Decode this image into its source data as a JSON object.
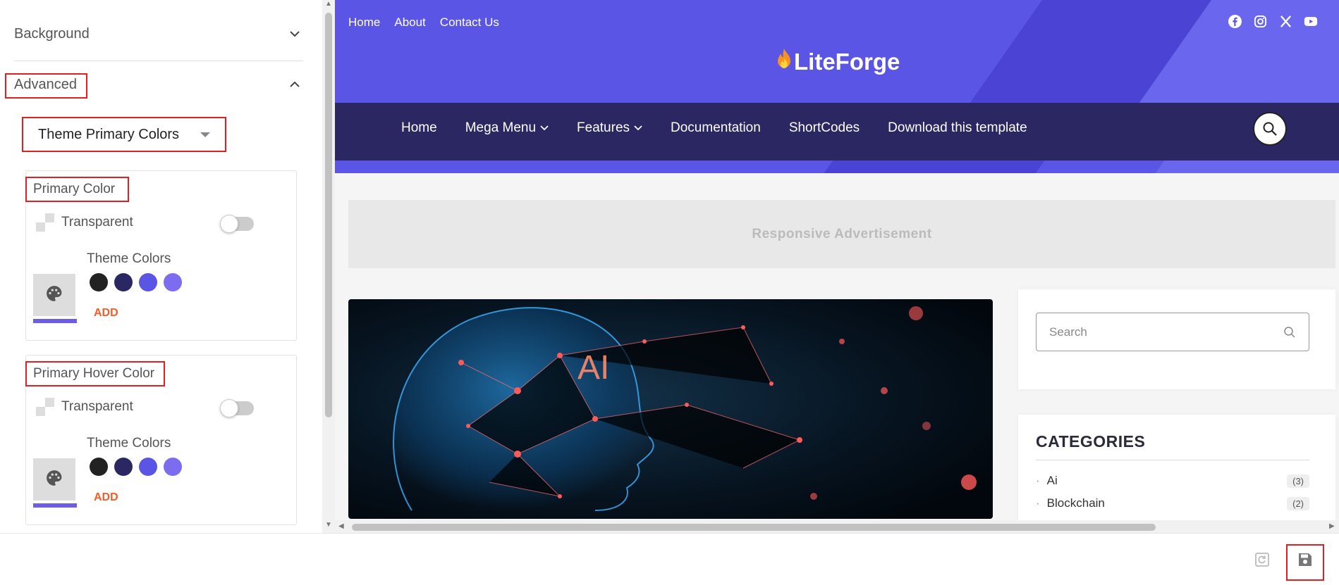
{
  "panel": {
    "background_label": "Background",
    "advanced_label": "Advanced",
    "select_value": "Theme Primary Colors",
    "cards": [
      {
        "title": "Primary Color",
        "transparent_label": "Transparent",
        "theme_colors_label": "Theme Colors",
        "add_label": "ADD",
        "transparent_on": false
      },
      {
        "title": "Primary Hover Color",
        "transparent_label": "Transparent",
        "theme_colors_label": "Theme Colors",
        "add_label": "ADD",
        "transparent_on": false
      }
    ],
    "theme_colors": [
      "#222222",
      "#2a2762",
      "#5b55e6",
      "#7b6cf0"
    ],
    "selected_swatch_color": "#6c5ce7"
  },
  "site": {
    "top_links": [
      "Home",
      "About",
      "Contact Us"
    ],
    "social_icons": [
      "facebook-icon",
      "instagram-icon",
      "x-icon",
      "youtube-icon"
    ],
    "logo_text": "LiteForge",
    "nav": {
      "home": "Home",
      "mega_menu": "Mega Menu",
      "features": "Features",
      "documentation": "Documentation",
      "shortcodes": "ShortCodes",
      "download": "Download this template"
    },
    "ad_text": "Responsive Advertisement",
    "hero_text": "AI",
    "search_placeholder": "Search",
    "categories_title": "CATEGORIES",
    "categories": [
      {
        "name": "Ai",
        "count": "(3)"
      },
      {
        "name": "Blockchain",
        "count": "(2)"
      }
    ],
    "brand_color": "#5b55e6",
    "nav_color": "#2a2762"
  },
  "footer": {
    "reset_icon": "reset-icon",
    "save_icon": "save-icon"
  }
}
